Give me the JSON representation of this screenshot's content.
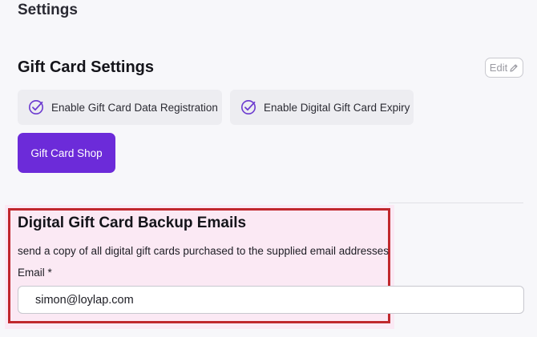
{
  "header": {
    "title": "Settings"
  },
  "gift_card_settings": {
    "title": "Gift Card Settings",
    "edit_label": "Edit",
    "options": [
      {
        "label": "Enable Gift Card Data Registration",
        "checked": true
      },
      {
        "label": "Enable Digital Gift Card Expiry",
        "checked": true
      }
    ],
    "shop_button_label": "Gift Card Shop"
  },
  "backup_emails": {
    "title": "Digital Gift Card Backup Emails",
    "description": "send a copy of all digital gift cards purchased to the supplied email addresses",
    "email_label": "Email *",
    "email_value": "simon@loylap.com"
  },
  "colors": {
    "accent": "#6c2bd9",
    "check": "#6c3bd0",
    "highlight_border": "#c0282d",
    "background": "#f7f7fa"
  },
  "icons": {
    "edit": "pencil-icon",
    "option": "check-circle-icon"
  }
}
